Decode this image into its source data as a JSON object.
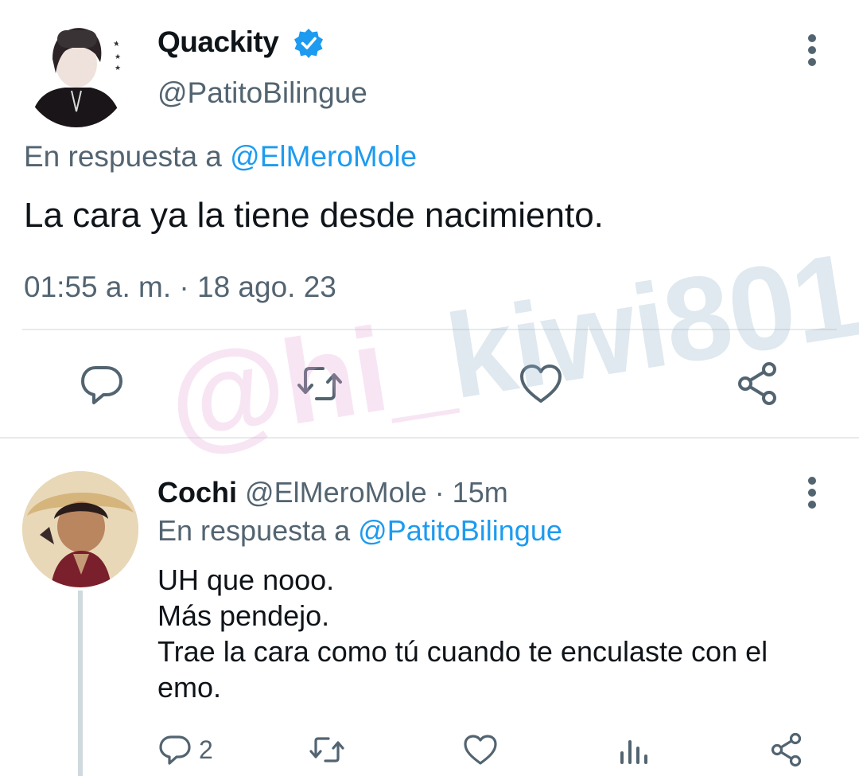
{
  "main_tweet": {
    "author_name": "Quackity",
    "handle": "@PatitoBilingue",
    "reply_prefix": "En respuesta a",
    "reply_to": "@ElMeroMole",
    "text": "La cara ya la tiene desde nacimiento.",
    "timestamp": "01:55 a. m. · 18 ago. 23",
    "actions": [
      "reply-icon",
      "retweet-icon",
      "like-icon",
      "share-icon"
    ]
  },
  "reply_tweet": {
    "author_name": "Cochi",
    "handle": "@ElMeroMole",
    "separator": "·",
    "time_ago": "15m",
    "reply_prefix": "En respuesta a",
    "reply_to": "@PatitoBilingue",
    "lines": [
      "UH que nooo.",
      "Más pendejo.",
      "Trae la cara como tú cuando te enculaste con el",
      "emo."
    ],
    "reply_count": "2",
    "actions": [
      "reply-icon",
      "retweet-icon",
      "like-icon",
      "analytics-icon",
      "share-icon"
    ]
  },
  "watermark": {
    "part1": "@hi_",
    "part2": "kiwi801"
  },
  "colors": {
    "accent": "#1d9bf0",
    "secondary_text": "#536471",
    "primary_text": "#0f1419",
    "divider": "#e7eaed"
  }
}
